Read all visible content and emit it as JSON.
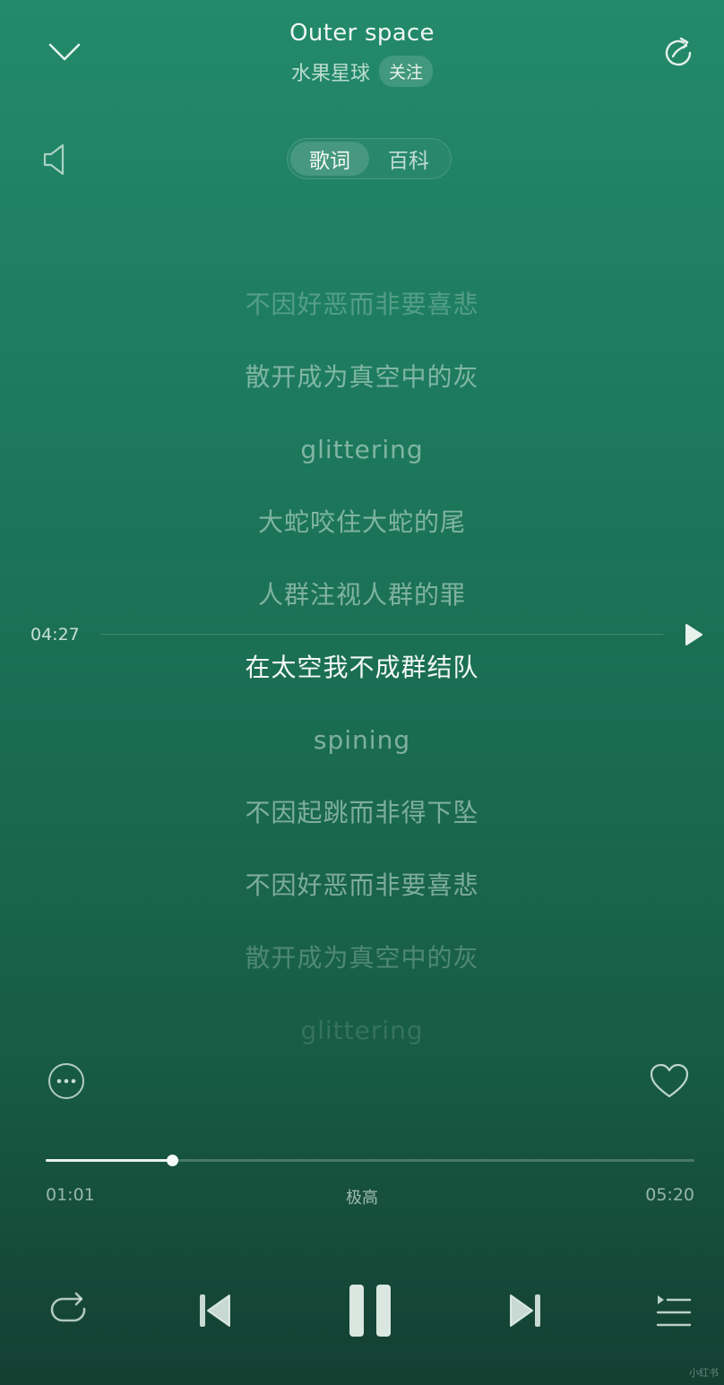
{
  "header": {
    "title": "Outer space",
    "artist": "水果星球",
    "follow_label": "关注"
  },
  "tabs": [
    {
      "label": "歌词",
      "active": true
    },
    {
      "label": "百科",
      "active": false
    }
  ],
  "lyrics": [
    {
      "text": "不因好恶而非要喜悲",
      "state": "fade1"
    },
    {
      "text": "散开成为真空中的灰",
      "state": "normal"
    },
    {
      "text": "glittering",
      "state": "normal"
    },
    {
      "text": "大蛇咬住大蛇的尾",
      "state": "normal"
    },
    {
      "text": "人群注视人群的罪",
      "state": "normal"
    },
    {
      "text": "在太空我不成群结队",
      "state": "current"
    },
    {
      "text": "spining",
      "state": "normal"
    },
    {
      "text": "不因起跳而非得下坠",
      "state": "normal"
    },
    {
      "text": "不因好恶而非要喜悲",
      "state": "normal"
    },
    {
      "text": "散开成为真空中的灰",
      "state": "fade1"
    },
    {
      "text": "glittering",
      "state": "fade2"
    }
  ],
  "lyric_seek": {
    "time": "04:27"
  },
  "progress": {
    "current": "01:01",
    "total": "05:20",
    "fraction": 0.195,
    "quality": "极高"
  },
  "icons": {
    "collapse": "chevron-down-icon",
    "share": "share-icon",
    "volume": "speaker-icon",
    "lyric_play": "play-icon",
    "more": "more-icon",
    "like": "heart-icon",
    "repeat": "repeat-icon",
    "previous": "previous-icon",
    "pause": "pause-icon",
    "next": "next-icon",
    "playlist": "playlist-icon"
  },
  "watermark": "小红书"
}
